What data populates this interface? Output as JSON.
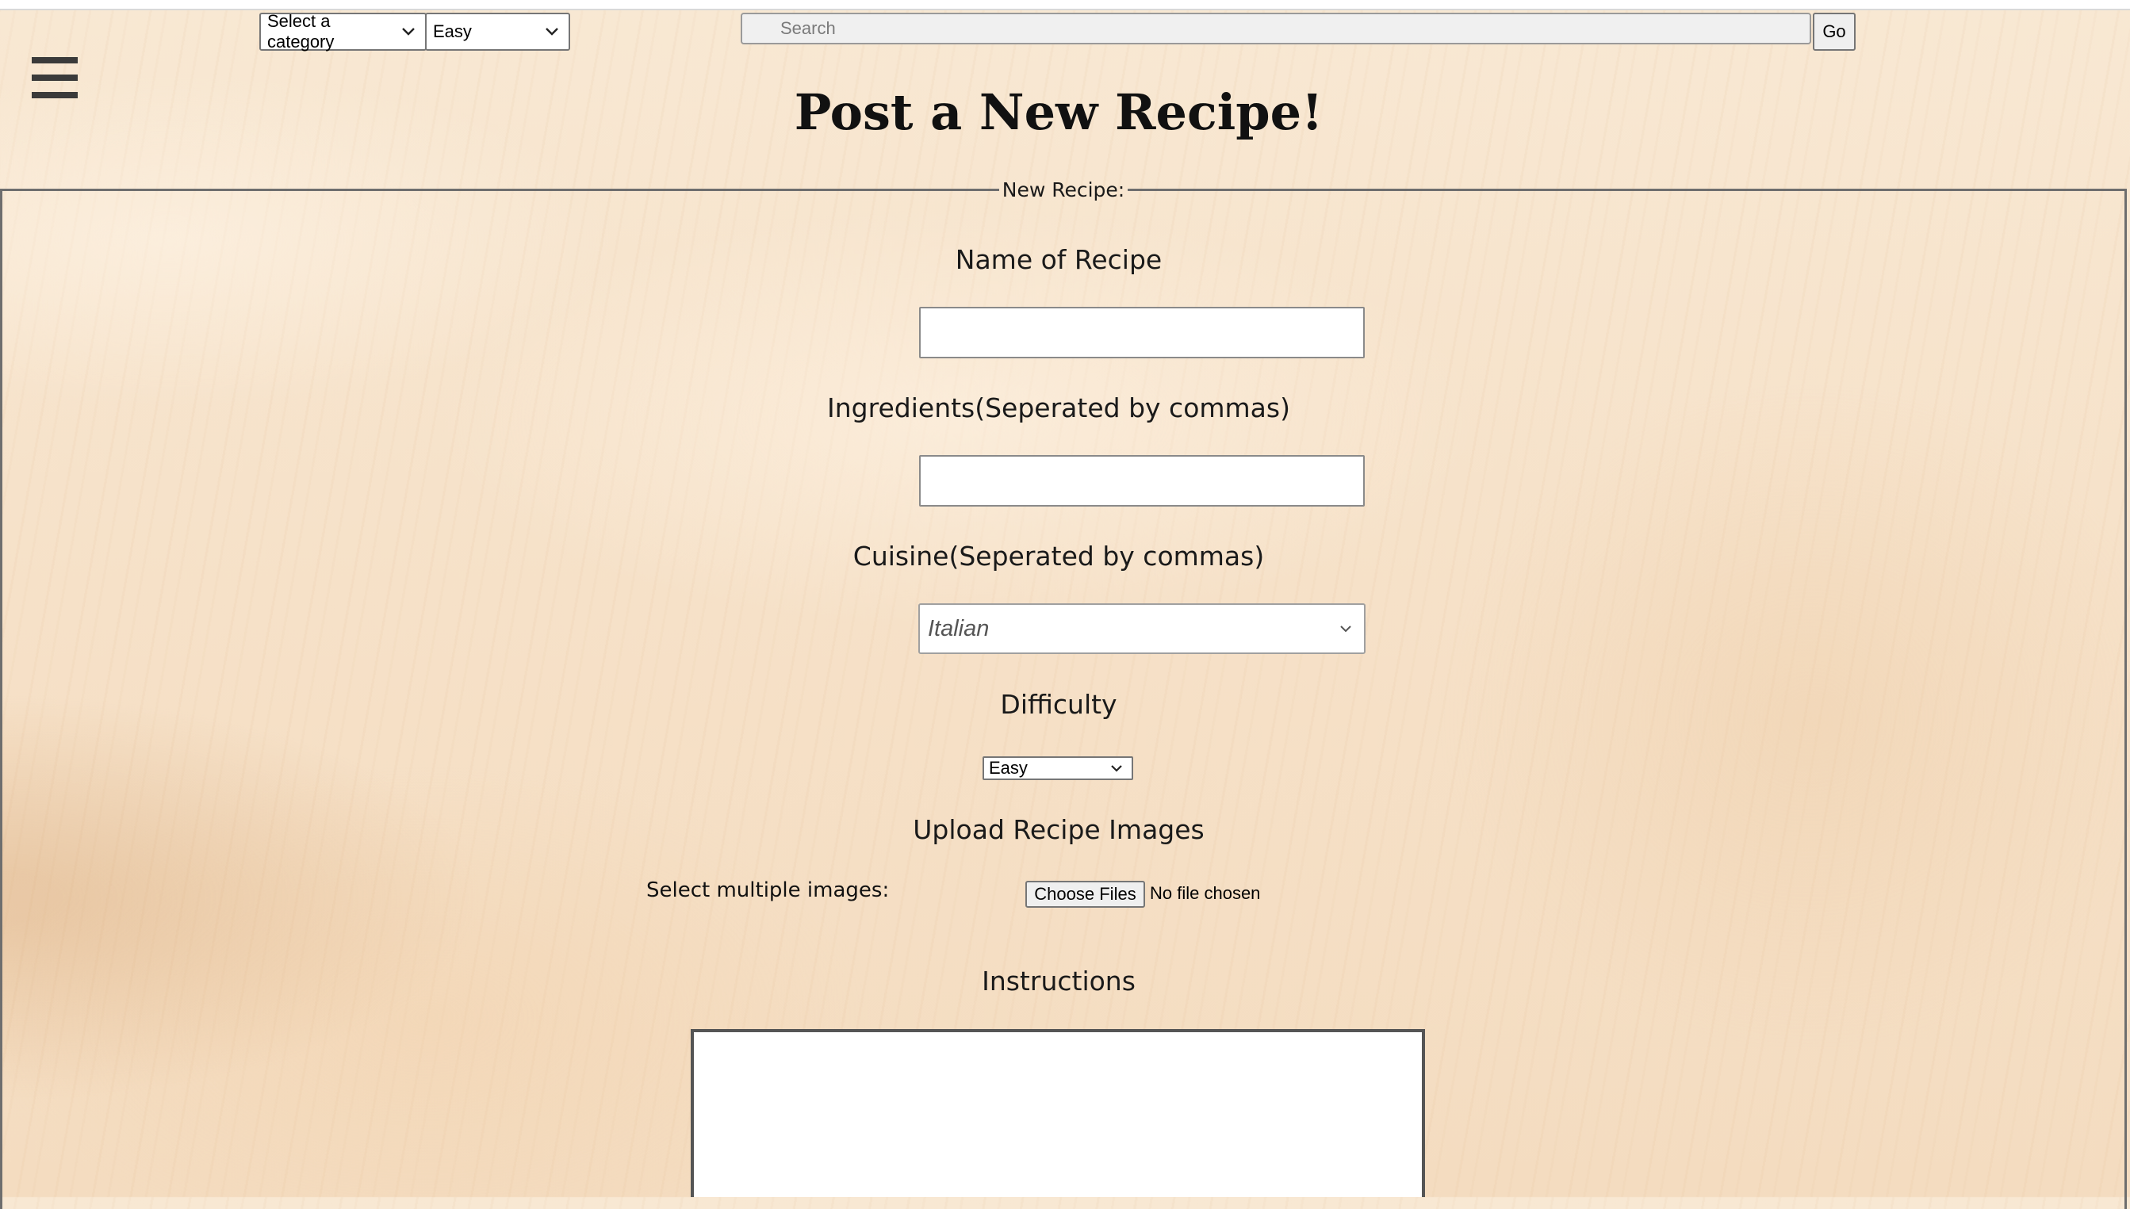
{
  "top_bar": {
    "category_select": {
      "selected": "Select a category"
    },
    "difficulty_filter": {
      "selected": "Easy"
    },
    "search": {
      "placeholder": "Search"
    },
    "go_label": "Go"
  },
  "title": "Post a New Recipe!",
  "form": {
    "legend": "New Recipe:",
    "name_label": "Name of Recipe",
    "ingredients_label": "Ingredients(Seperated by commas)",
    "cuisine_label": "Cuisine(Seperated by commas)",
    "cuisine_value": "Italian",
    "difficulty_label": "Difficulty",
    "difficulty_value": "Easy",
    "upload_label": "Upload Recipe Images",
    "select_images_label": "Select multiple images:",
    "choose_files_label": "Choose Files",
    "file_status": "No file chosen",
    "instructions_label": "Instructions"
  },
  "icons": {
    "menu": "hamburger-menu-icon",
    "dropdown": "chevron-down-icon"
  },
  "colors": {
    "background": "#f7e4cd",
    "border": "#6e6e6e"
  }
}
